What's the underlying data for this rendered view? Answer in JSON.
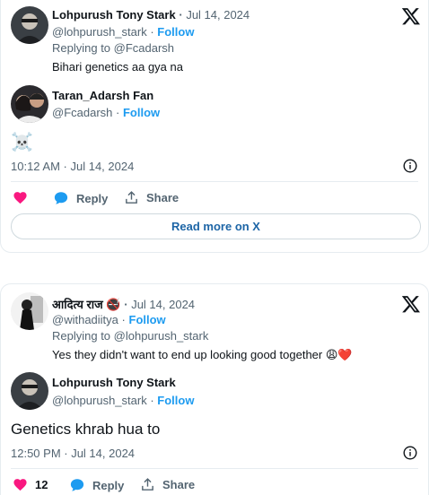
{
  "tweet1": {
    "author": {
      "name": "Lohpurush Tony Stark",
      "handle": "@lohpurush_stark",
      "date": "Jul 14, 2024"
    },
    "follow_label": "Follow",
    "replying_to": "Replying to @Fcadarsh",
    "text": "Bihari genetics aa gya na",
    "quoted": {
      "name": "Taran_Adarsh Fan",
      "handle": "@Fcadarsh",
      "follow_label": "Follow",
      "text": "☠️"
    },
    "timestamp": "10:12 AM · Jul 14, 2024",
    "actions": {
      "like_count": "",
      "reply_label": "Reply",
      "share_label": "Share"
    },
    "read_more_label": "Read more on X"
  },
  "tweet2": {
    "author": {
      "name": "आदित्य राज 🚭",
      "handle": "@withadiitya",
      "date": "Jul 14, 2024"
    },
    "follow_label": "Follow",
    "replying_to": "Replying to @lohpurush_stark",
    "text": "Yes they didn't want to end up looking good together 😩❤️",
    "quoted": {
      "name": "Lohpurush Tony Stark",
      "handle": "@lohpurush_stark",
      "follow_label": "Follow",
      "text": "Genetics khrab hua to"
    },
    "timestamp": "12:50 PM · Jul 14, 2024",
    "actions": {
      "like_count": "12",
      "reply_label": "Reply",
      "share_label": "Share"
    }
  },
  "colors": {
    "accent": "#1d9bf0",
    "like": "#f91880",
    "muted": "#536471",
    "text": "#0f1419"
  },
  "icons": [
    "x-logo-icon",
    "info-icon",
    "heart-icon",
    "reply-icon",
    "share-icon"
  ]
}
